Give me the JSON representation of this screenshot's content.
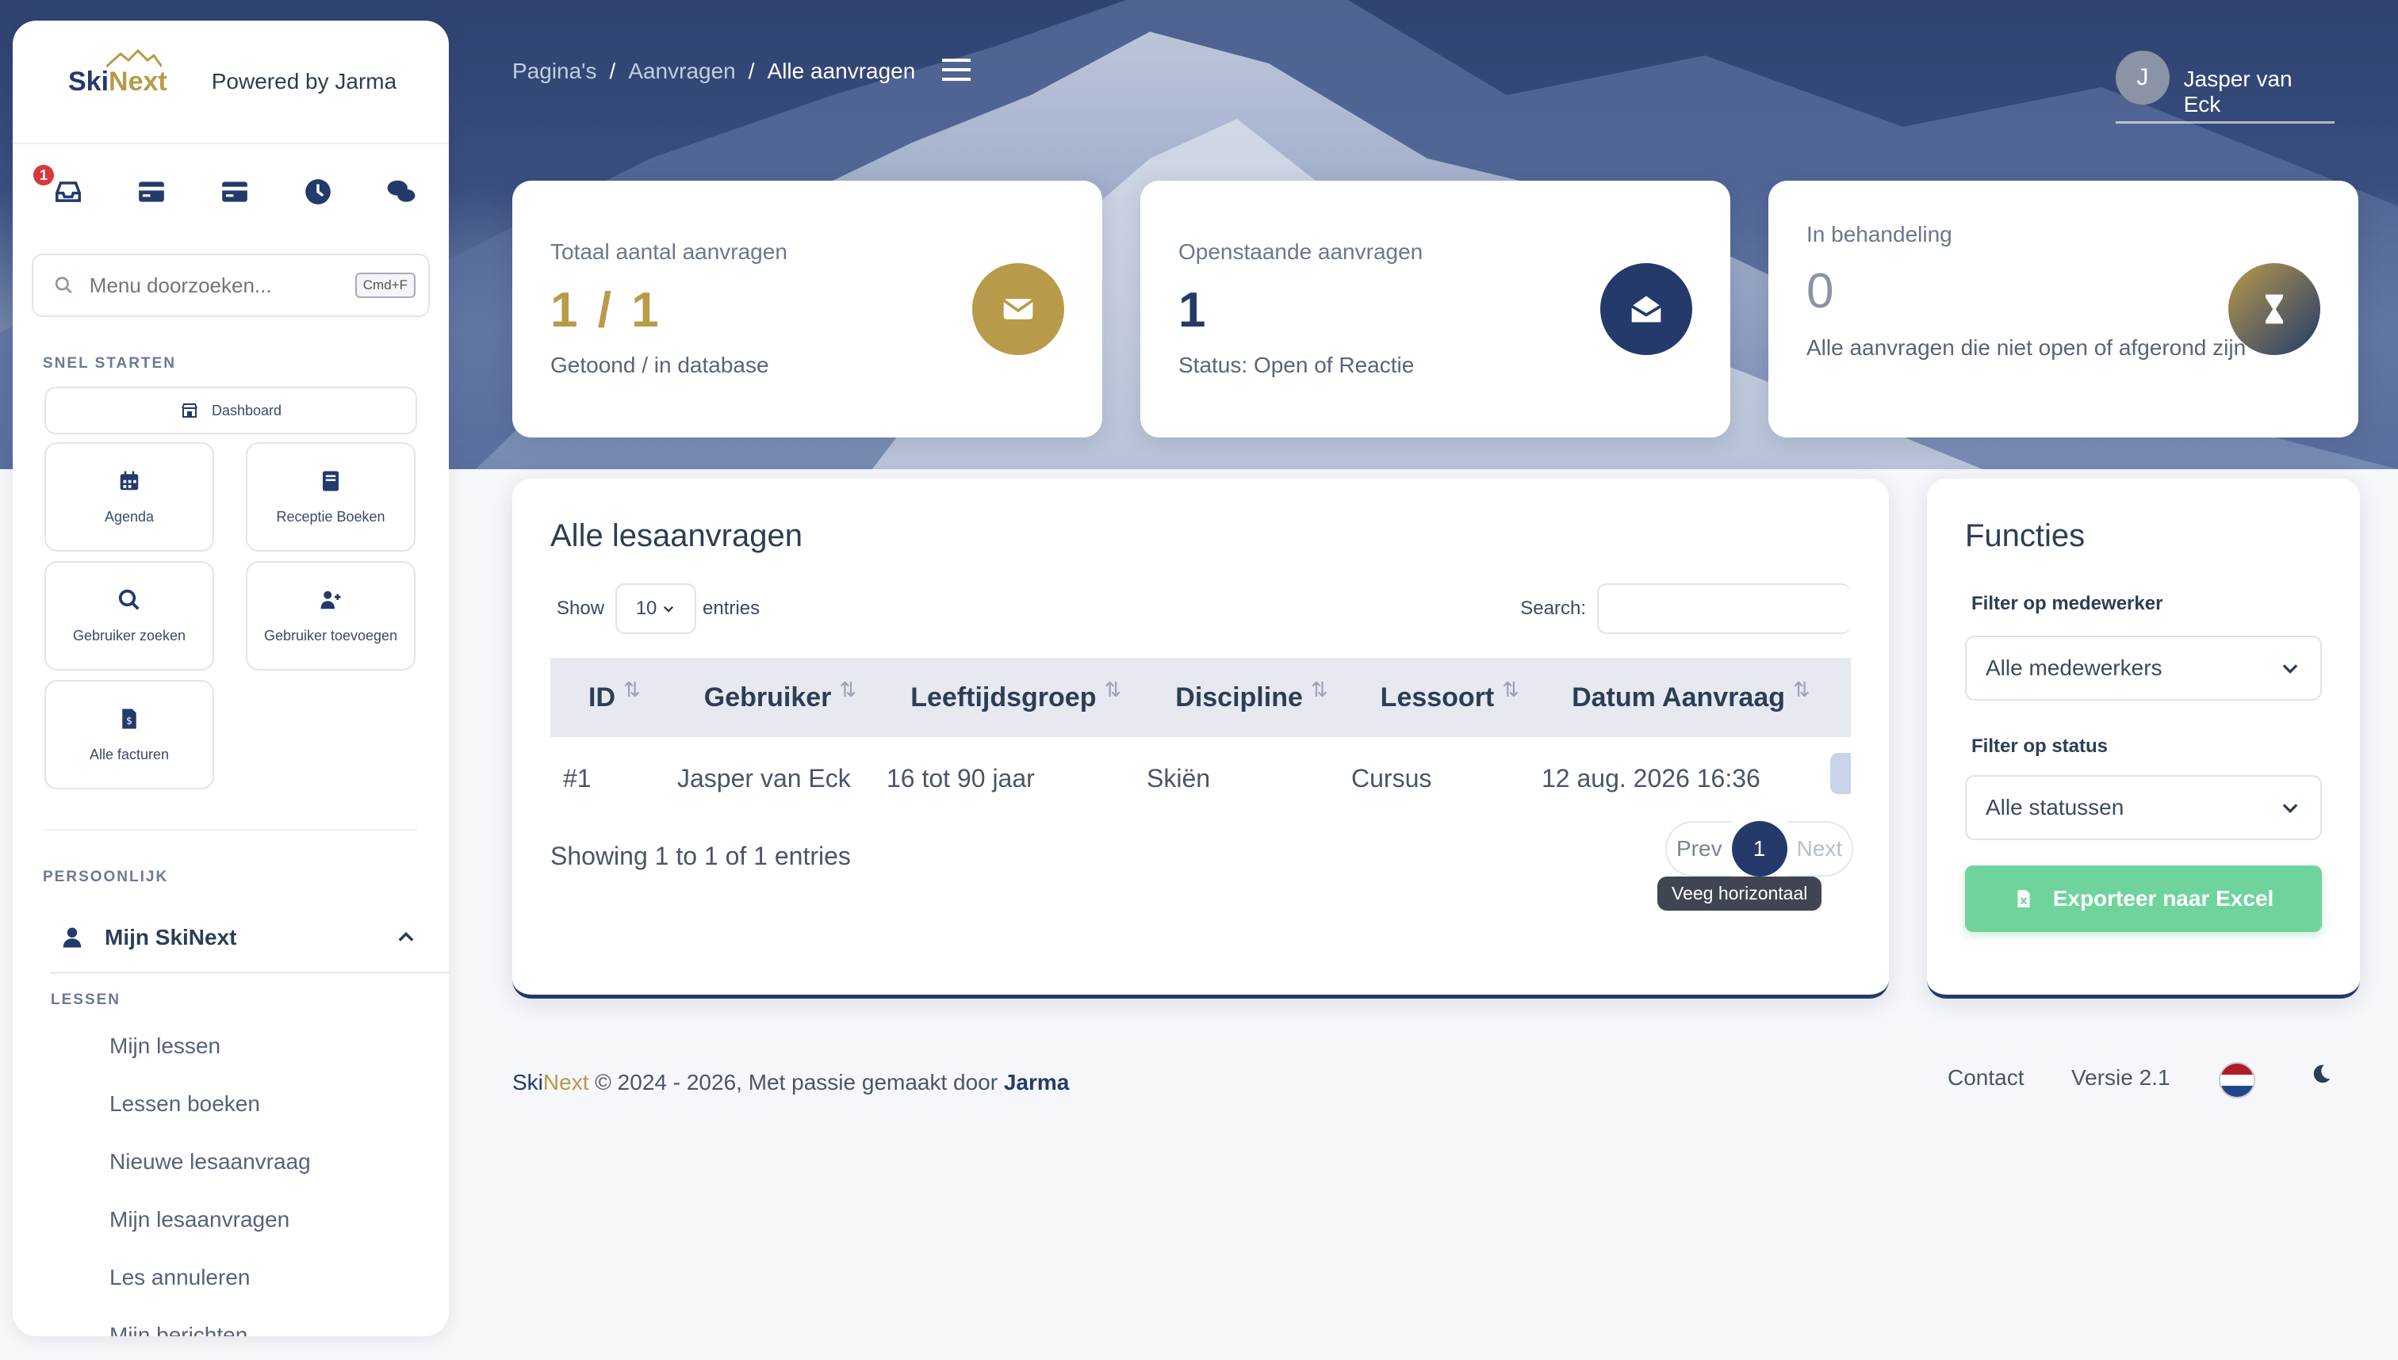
{
  "sidebar": {
    "brand": {
      "logo_part1": "Ski",
      "logo_part2": "Next",
      "powered": "Powered by Jarma"
    },
    "quick_icons": [
      {
        "icon": "inbox-icon",
        "badge": "1"
      },
      {
        "icon": "card-icon"
      },
      {
        "icon": "card-icon"
      },
      {
        "icon": "clock-icon"
      },
      {
        "icon": "chat-icon"
      }
    ],
    "search": {
      "placeholder": "Menu doorzoeken...",
      "shortcut": "Cmd+F"
    },
    "quick_start_label": "SNEL STARTEN",
    "dashboard": "Dashboard",
    "tiles": [
      "Agenda",
      "Receptie Boeken",
      "Gebruiker zoeken",
      "Gebruiker toevoegen",
      "Alle facturen"
    ],
    "personal_label": "PERSOONLIJK",
    "mijn": "Mijn SkiNext",
    "lessen_label": "LESSEN",
    "lessen_items": [
      "Mijn lessen",
      "Lessen boeken",
      "Nieuwe lesaanvraag",
      "Mijn lesaanvragen",
      "Les annuleren",
      "Mijn berichten"
    ]
  },
  "header": {
    "breadcrumbs": [
      "Pagina's",
      "Aanvragen",
      "Alle aanvragen"
    ],
    "user": {
      "initial": "J",
      "name": "Jasper van Eck"
    }
  },
  "stats": [
    {
      "label": "Totaal aantal aanvragen",
      "value": "1 / 1",
      "sub": "Getoond / in database",
      "color": "#b89a4b",
      "icon": "envelope-icon"
    },
    {
      "label": "Openstaande aanvragen",
      "value": "1",
      "sub": "Status: Open of Reactie",
      "color": "#233a6b",
      "icon": "envelope-open-icon"
    },
    {
      "label": "In behandeling",
      "value": "0",
      "sub": "Alle aanvragen die niet open of afgerond zijn",
      "color": "#8a7a45",
      "icon": "hourglass-icon"
    }
  ],
  "table": {
    "title": "Alle lesaanvragen",
    "show": "Show",
    "entries_value": "10",
    "entries": "entries",
    "search_label": "Search:",
    "columns": [
      "ID",
      "Gebruiker",
      "Leeftijdsgroep",
      "Discipline",
      "Lessoort",
      "Datum Aanvraag"
    ],
    "rows": [
      [
        "#1",
        "Jasper van Eck",
        "16 tot 90 jaar",
        "Skiën",
        "Cursus",
        "12 aug. 2026 16:36"
      ]
    ],
    "showing": "Showing 1 to 1 of 1 entries",
    "prev": "Prev",
    "page": "1",
    "next": "Next",
    "tooltip": "Veeg horizontaal"
  },
  "functies": {
    "title": "Functies",
    "filter_medewerker_label": "Filter op medewerker",
    "filter_medewerker_value": "Alle medewerkers",
    "filter_status_label": "Filter op status",
    "filter_status_value": "Alle statussen",
    "export": "Exporteer naar Excel"
  },
  "footer": {
    "ski": "Ski",
    "next": "Next",
    "text": " © 2024 - 2026, Met passie gemaakt door ",
    "author": "Jarma",
    "contact": "Contact",
    "version": "Versie 2.1"
  }
}
